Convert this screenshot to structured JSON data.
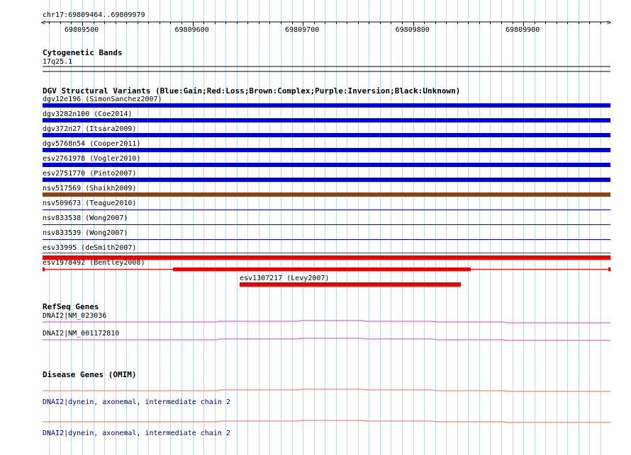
{
  "region": {
    "label": "chr17:69809464..69809979",
    "start": 69809464,
    "end": 69809979,
    "ticks": [
      "69809500",
      "69809600",
      "69809700",
      "69809800",
      "69809900"
    ]
  },
  "cytogenetic": {
    "title": "Cytogenetic Bands",
    "band": "17q25.1"
  },
  "dgv": {
    "title": "DGV Structural Variants (Blue:Gain;Red:Loss;Brown:Complex;Purple:Inversion;Black:Unknown)",
    "colors": {
      "gain": "#0000dd",
      "loss": "#ee0000",
      "complex": "#8b4513"
    },
    "variants": [
      {
        "label": "dgv12e196 (SimonSanchez2007)",
        "type": "gain",
        "style": "thick"
      },
      {
        "label": "dgv3282n100 (Coe2014)",
        "type": "gain",
        "style": "thick"
      },
      {
        "label": "dgv372n27 (Itsara2009)",
        "type": "gain",
        "style": "thick"
      },
      {
        "label": "dgv5768n54 (Cooper2011)",
        "type": "gain",
        "style": "thick"
      },
      {
        "label": "esv2761978 (Vogler2010)",
        "type": "gain",
        "style": "thick"
      },
      {
        "label": "esv2751770 (Pinto2007)",
        "type": "gain",
        "style": "thick"
      },
      {
        "label": "nsv517569 (Shaikh2009)",
        "type": "complex",
        "style": "thick"
      },
      {
        "label": "nsv509673 (Teague2010)",
        "type": "gain",
        "style": "thin"
      },
      {
        "label": "nsv833538 (Wong2007)",
        "type": "gain",
        "style": "thin"
      },
      {
        "label": "nsv833539 (Wong2007)",
        "type": "gain",
        "style": "thin"
      },
      {
        "label": "esv33995 (deSmith2007)",
        "type": "loss",
        "style": "thin-thick"
      },
      {
        "label": "esv1978492 (Bentley2008)",
        "type": "loss",
        "style": "partial"
      }
    ],
    "extra": {
      "label": "esv1307217 (Levy2007)",
      "type": "loss"
    }
  },
  "refseq": {
    "title": "RefSeq Genes",
    "color": "#cc44cc",
    "genes": [
      {
        "label": "DNAI2|NM_023036"
      },
      {
        "label": "DNAI2|NM_001172810"
      }
    ]
  },
  "omim": {
    "title": "Disease Genes (OMIM)",
    "color": "#e07050",
    "genes": [
      {
        "label": "DNAI2|dynein, axonemal, intermediate chain 2"
      },
      {
        "label": "DNAI2|dynein, axonemal, intermediate chain 2"
      }
    ]
  }
}
